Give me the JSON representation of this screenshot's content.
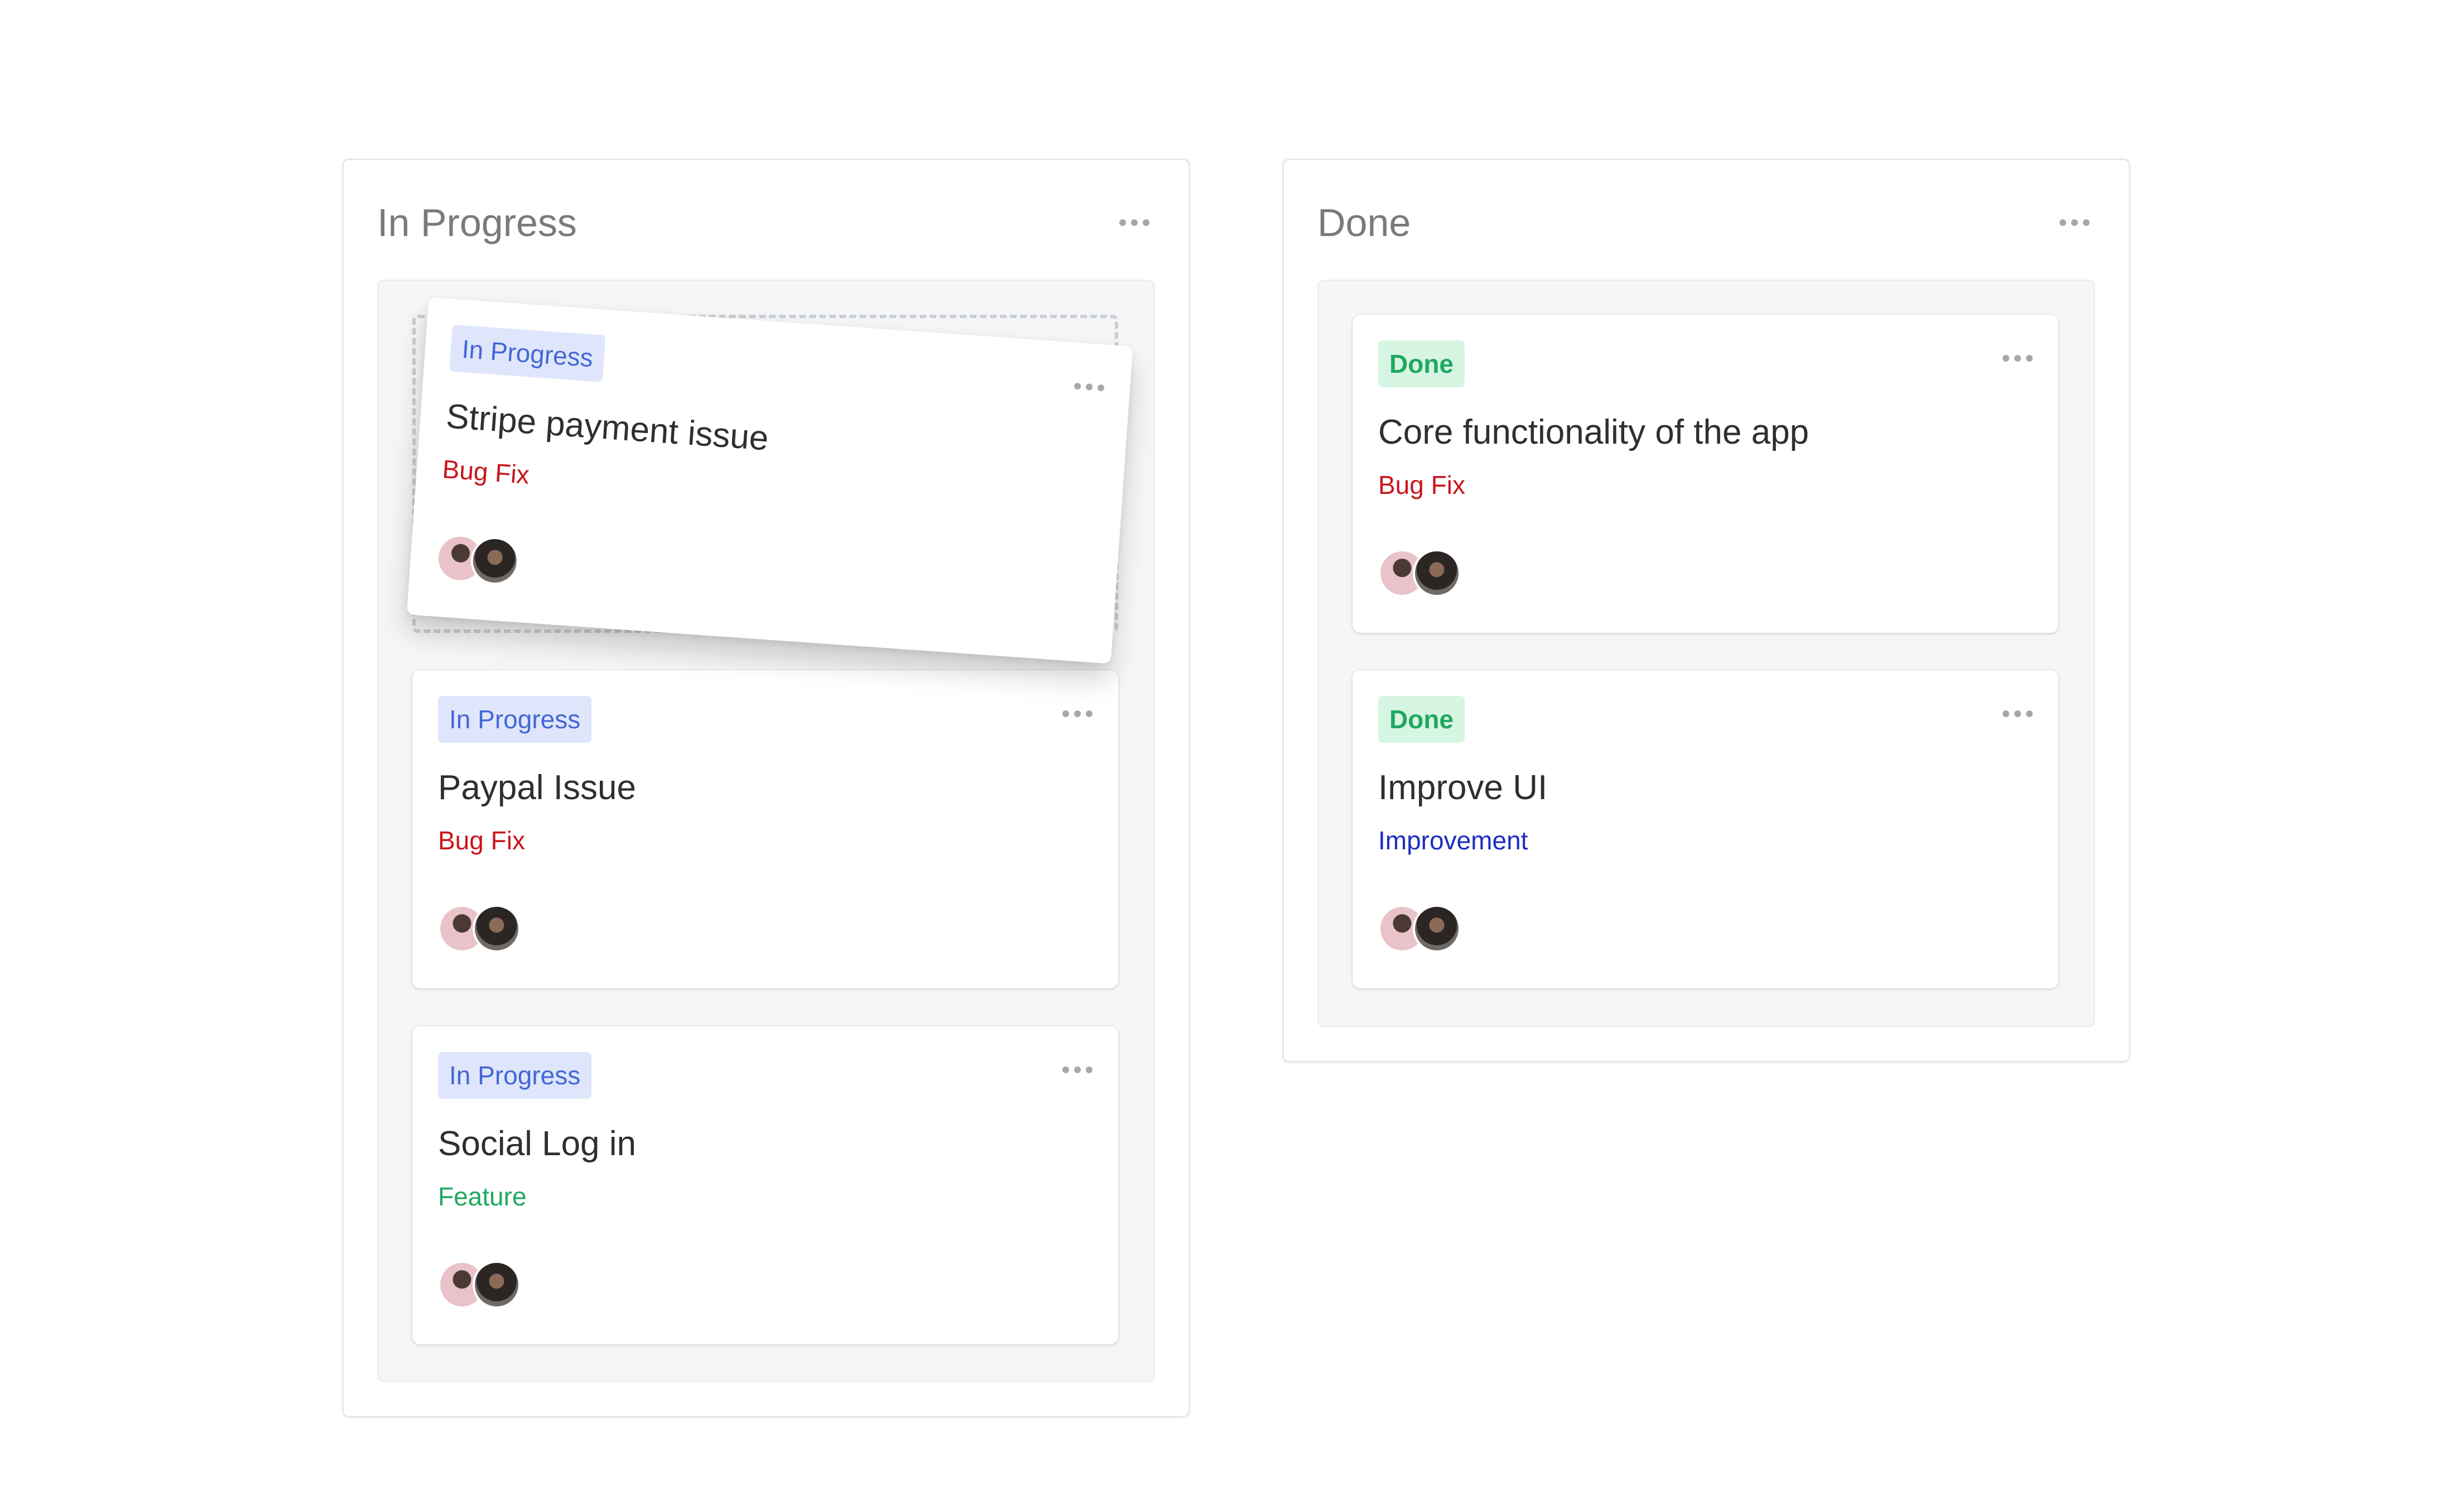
{
  "columns": [
    {
      "title": "In Progress",
      "cards": [
        {
          "status": "In Progress",
          "title": "Stripe payment issue",
          "tag": "Bug Fix",
          "tag_color": "#c8161d",
          "dragging": true
        },
        {
          "status": "In Progress",
          "title": "Paypal Issue",
          "tag": "Bug Fix",
          "tag_color": "#c8161d"
        },
        {
          "status": "In Progress",
          "title": "Social Log in",
          "tag": "Feature",
          "tag_color": "#21a860"
        }
      ]
    },
    {
      "title": "Done",
      "cards": [
        {
          "status": "Done",
          "title": "Core functionality of the app",
          "tag": "Bug Fix",
          "tag_color": "#c8161d"
        },
        {
          "status": "Done",
          "title": "Improve UI",
          "tag": "Improvement",
          "tag_color": "#1b2ec0"
        }
      ]
    }
  ],
  "icons": {
    "menu": "more-horizontal-icon",
    "avatar": "user-avatar"
  }
}
